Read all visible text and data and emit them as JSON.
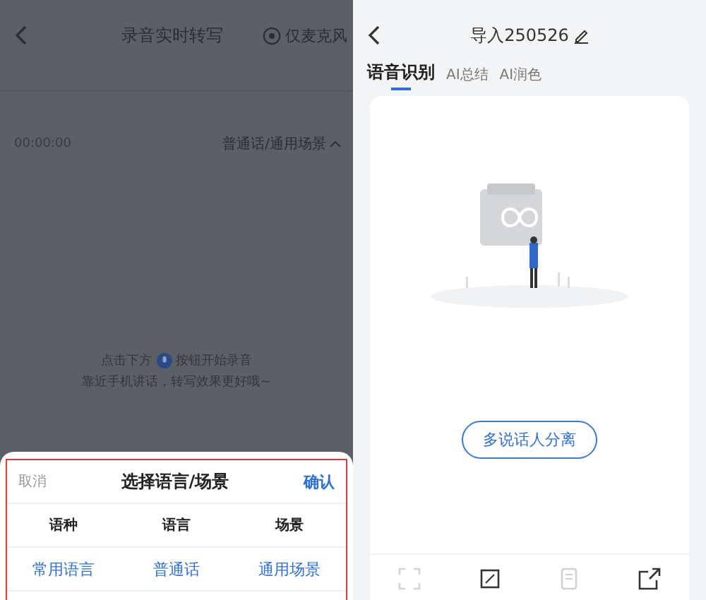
{
  "left_screen": {
    "header": {
      "title": "录音实时转写",
      "mic_option": "仅麦克风"
    },
    "timer": "00:00:00",
    "language_scene": "普通话/通用场景",
    "hint": {
      "before_icon": "点击下方",
      "after_icon": "按钮开始录音",
      "line_2": "靠近手机讲话，转写效果更好哦~"
    },
    "picker": {
      "cancel": "取消",
      "title": "选择语言/场景",
      "confirm": "确认",
      "columns": [
        "语种",
        "语言",
        "场景"
      ],
      "options": [
        {
          "label": "常用语言",
          "selected": true
        },
        {
          "label": "普通话",
          "selected": true
        },
        {
          "label": "通用场景",
          "selected": true
        }
      ]
    }
  },
  "right_screen": {
    "header": {
      "title": "导入250526"
    },
    "tabs": [
      {
        "label": "语音识别",
        "selected": true
      },
      {
        "label": "AI总结",
        "selected": false
      },
      {
        "label": "AI润色",
        "selected": false
      }
    ],
    "speaker_button": "多说话人分离",
    "toolbar": [
      {
        "kind": "expand",
        "disabled": true
      },
      {
        "kind": "crop",
        "disabled": false
      },
      {
        "kind": "note",
        "disabled": true
      },
      {
        "kind": "share",
        "disabled": false
      }
    ]
  }
}
